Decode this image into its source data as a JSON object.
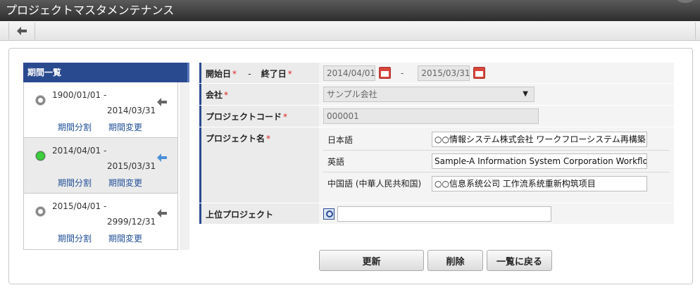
{
  "window": {
    "title": "プロジェクトマスタメンテナンス"
  },
  "toolbar": {
    "back_icon": "arrow-left-icon"
  },
  "sidebar": {
    "title": "期間一覧",
    "periods": [
      {
        "start": "1900/01/01  -",
        "end": "2014/03/31",
        "split": "期間分割",
        "change": "期間変更",
        "selected": false
      },
      {
        "start": "2014/04/01  -",
        "end": "2015/03/31",
        "split": "期間分割",
        "change": "期間変更",
        "selected": true
      },
      {
        "start": "2015/04/01  -",
        "end": "2999/12/31",
        "split": "期間分割",
        "change": "期間変更",
        "selected": false
      }
    ]
  },
  "form": {
    "period": {
      "start_label": "開始日",
      "separator_label": "-",
      "end_label": "終了日",
      "required_mark": "*",
      "start_value": "2014/04/01",
      "range_dash": "-",
      "end_value": "2015/03/31"
    },
    "company": {
      "label": "会社",
      "value": "サンプル会社"
    },
    "project_code": {
      "label": "プロジェクトコード",
      "value": "000001"
    },
    "project_name": {
      "label": "プロジェクト名",
      "languages": [
        {
          "label": "日本語",
          "value": "○○情報システム株式会社 ワークフローシステム再構築"
        },
        {
          "label": "英語",
          "value": "Sample-A Information System Corporation Workflow"
        },
        {
          "label": "中国語 (中華人民共和国)",
          "value": "○○信息系统公司 工作流系统重新构筑项目"
        }
      ]
    },
    "parent_project": {
      "label": "上位プロジェクト",
      "value": ""
    }
  },
  "buttons": {
    "update": "更新",
    "delete": "削除",
    "back_to_list": "一覧に戻る"
  },
  "colors": {
    "accent": "#2a4a8f",
    "required": "#dd2222",
    "link": "#1f4e96"
  }
}
